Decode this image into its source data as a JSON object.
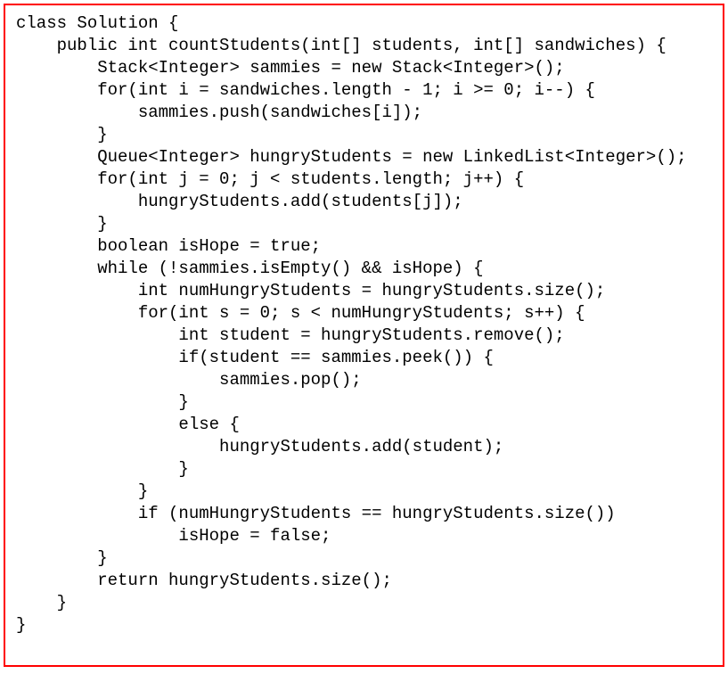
{
  "code": {
    "lines": [
      "class Solution {",
      "    public int countStudents(int[] students, int[] sandwiches) {",
      "        Stack<Integer> sammies = new Stack<Integer>();",
      "        for(int i = sandwiches.length - 1; i >= 0; i--) {",
      "            sammies.push(sandwiches[i]);",
      "        }",
      "        Queue<Integer> hungryStudents = new LinkedList<Integer>();",
      "        for(int j = 0; j < students.length; j++) {",
      "            hungryStudents.add(students[j]);",
      "        }",
      "        boolean isHope = true;",
      "        while (!sammies.isEmpty() && isHope) {",
      "            int numHungryStudents = hungryStudents.size();",
      "            for(int s = 0; s < numHungryStudents; s++) {",
      "                int student = hungryStudents.remove();",
      "                if(student == sammies.peek()) {",
      "                    sammies.pop();",
      "                }",
      "                else {",
      "                    hungryStudents.add(student);",
      "                }",
      "            }",
      "            if (numHungryStudents == hungryStudents.size())",
      "                isHope = false;",
      "        }",
      "        return hungryStudents.size();",
      "    }",
      "}"
    ]
  }
}
